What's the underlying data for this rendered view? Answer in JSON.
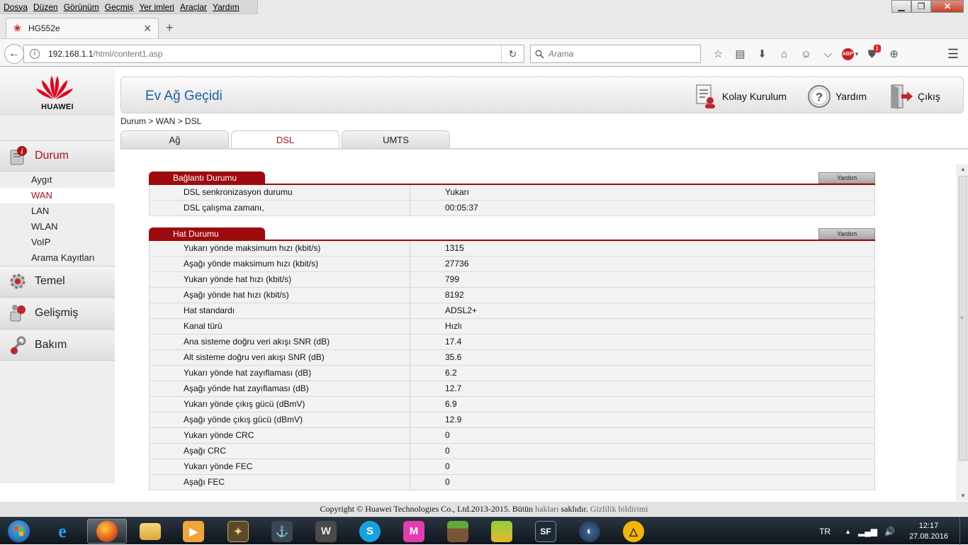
{
  "browser": {
    "menu": [
      "Dosya",
      "Düzen",
      "Görünüm",
      "Geçmiş",
      "Yer imleri",
      "Araçlar",
      "Yardım"
    ],
    "tab_title": "HG552e",
    "url_host": "192.168.1.1",
    "url_path": "/html/content1.asp",
    "search_placeholder": "Arama",
    "notification_count": "1",
    "abp_label": "ABP"
  },
  "router": {
    "brand": "HUAWEI",
    "gateway_title": "Ev Ağ Geçidi",
    "top_links": {
      "setup": "Kolay Kurulum",
      "help": "Yardım",
      "logout": "Çıkış"
    },
    "breadcrumb": "Durum > WAN > DSL",
    "tabs": [
      "Ağ",
      "DSL",
      "UMTS"
    ],
    "sidebar": {
      "status": "Durum",
      "status_items": [
        "Aygıt",
        "WAN",
        "LAN",
        "WLAN",
        "VoIP",
        "Arama Kayıtları"
      ],
      "basic": "Temel",
      "advanced": "Gelişmiş",
      "maintenance": "Bakım"
    },
    "connection": {
      "title": "Bağlantı Durumu",
      "help": "Yardım",
      "rows": [
        {
          "label": "DSL senkronizasyon durumu",
          "value": "Yukarı"
        },
        {
          "label": "DSL çalışma zamanı,",
          "value": "00:05:37"
        }
      ]
    },
    "line": {
      "title": "Hat Durumu",
      "help": "Yardım",
      "rows": [
        {
          "label": "Yukarı yönde maksimum hızı (kbit/s)",
          "value": "1315"
        },
        {
          "label": "Aşağı yönde maksimum hızı (kbit/s)",
          "value": "27736"
        },
        {
          "label": "Yukarı yönde hat hızı (kbit/s)",
          "value": "799"
        },
        {
          "label": "Aşağı yönde hat hızı (kbit/s)",
          "value": "8192"
        },
        {
          "label": "Hat standardı",
          "value": "ADSL2+"
        },
        {
          "label": "Kanal türü",
          "value": "Hızlı"
        },
        {
          "label": "Ana sisteme doğru veri akışı SNR (dB)",
          "value": "17.4"
        },
        {
          "label": "Alt sisteme doğru veri akışı SNR (dB)",
          "value": "35.6"
        },
        {
          "label": "Yukarı yönde hat zayıflaması (dB)",
          "value": "6.2"
        },
        {
          "label": "Aşağı yönde hat zayıflaması (dB)",
          "value": "12.7"
        },
        {
          "label": "Yukarı yönde çıkış gücü (dBmV)",
          "value": "6.9"
        },
        {
          "label": "Aşağı yönde çıkış gücü (dBmV)",
          "value": "12.9"
        },
        {
          "label": "Yukarı yönde CRC",
          "value": "0"
        },
        {
          "label": "Aşağı CRC",
          "value": "0"
        },
        {
          "label": "Yukarı yönde FEC",
          "value": "0"
        },
        {
          "label": "Aşağı FEC",
          "value": "0"
        }
      ]
    },
    "footer": {
      "copyright": "Copyright © Huawei Technologies Co., Ltd.2013-2015. Bütün ",
      "rights_link": "hakları",
      "rights_rest": " saklıdır. ",
      "privacy": "Gizlilik bildirimi"
    }
  },
  "taskbar": {
    "language": "TR",
    "time": "12:17",
    "date": "27.08.2016",
    "apps": [
      "internet-explorer",
      "firefox",
      "file-explorer",
      "media-player",
      "game-1",
      "world-of-warships",
      "world-of-tanks",
      "skype",
      "app-m",
      "minecraft",
      "bluestacks",
      "steam-like",
      "teamspeak",
      "triangle-app"
    ]
  },
  "colors": {
    "accent_red": "#9e0b0f",
    "title_blue": "#1d5fa0"
  }
}
